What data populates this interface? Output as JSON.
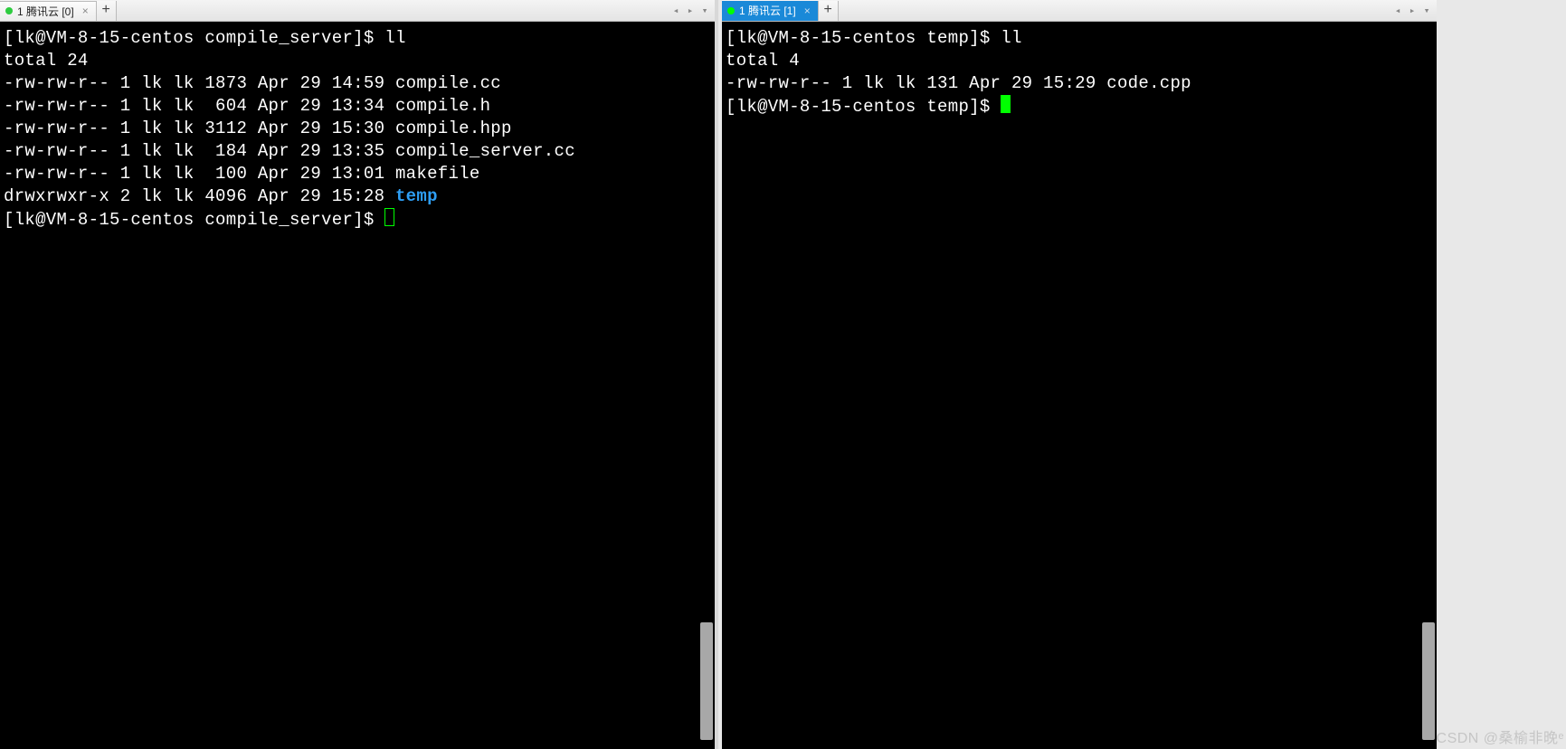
{
  "left": {
    "tab": {
      "title": "1 腾讯云 [0]",
      "dot": "green"
    },
    "addGlyph": "+",
    "nav": {
      "prev": "◂",
      "next": "▸",
      "menu": "▾"
    },
    "lines": [
      {
        "segments": [
          {
            "text": "[lk@VM-8-15-centos compile_server]$ ll"
          }
        ]
      },
      {
        "segments": [
          {
            "text": "total 24"
          }
        ]
      },
      {
        "segments": [
          {
            "text": "-rw-rw-r-- 1 lk lk 1873 Apr 29 14:59 compile.cc"
          }
        ]
      },
      {
        "segments": [
          {
            "text": "-rw-rw-r-- 1 lk lk  604 Apr 29 13:34 compile.h"
          }
        ]
      },
      {
        "segments": [
          {
            "text": "-rw-rw-r-- 1 lk lk 3112 Apr 29 15:30 compile.hpp"
          }
        ]
      },
      {
        "segments": [
          {
            "text": "-rw-rw-r-- 1 lk lk  184 Apr 29 13:35 compile_server.cc"
          }
        ]
      },
      {
        "segments": [
          {
            "text": "-rw-rw-r-- 1 lk lk  100 Apr 29 13:01 makefile"
          }
        ]
      },
      {
        "segments": [
          {
            "text": "drwxrwxr-x 2 lk lk 4096 Apr 29 15:28 "
          },
          {
            "text": "temp",
            "class": "dir-color"
          }
        ]
      },
      {
        "segments": [
          {
            "text": "[lk@VM-8-15-centos compile_server]$ "
          }
        ],
        "cursor": "outline"
      }
    ]
  },
  "right": {
    "tab": {
      "title": "1 腾讯云 [1]",
      "dot": "green"
    },
    "addGlyph": "+",
    "nav": {
      "prev": "◂",
      "next": "▸",
      "menu": "▾"
    },
    "lines": [
      {
        "segments": [
          {
            "text": "[lk@VM-8-15-centos temp]$ ll"
          }
        ]
      },
      {
        "segments": [
          {
            "text": "total 4"
          }
        ]
      },
      {
        "segments": [
          {
            "text": "-rw-rw-r-- 1 lk lk 131 Apr 29 15:29 code.cpp"
          }
        ]
      },
      {
        "segments": [
          {
            "text": "[lk@VM-8-15-centos temp]$ "
          }
        ],
        "cursor": "solid"
      }
    ]
  },
  "watermark": "CSDN @桑榆非晚ᵉ"
}
